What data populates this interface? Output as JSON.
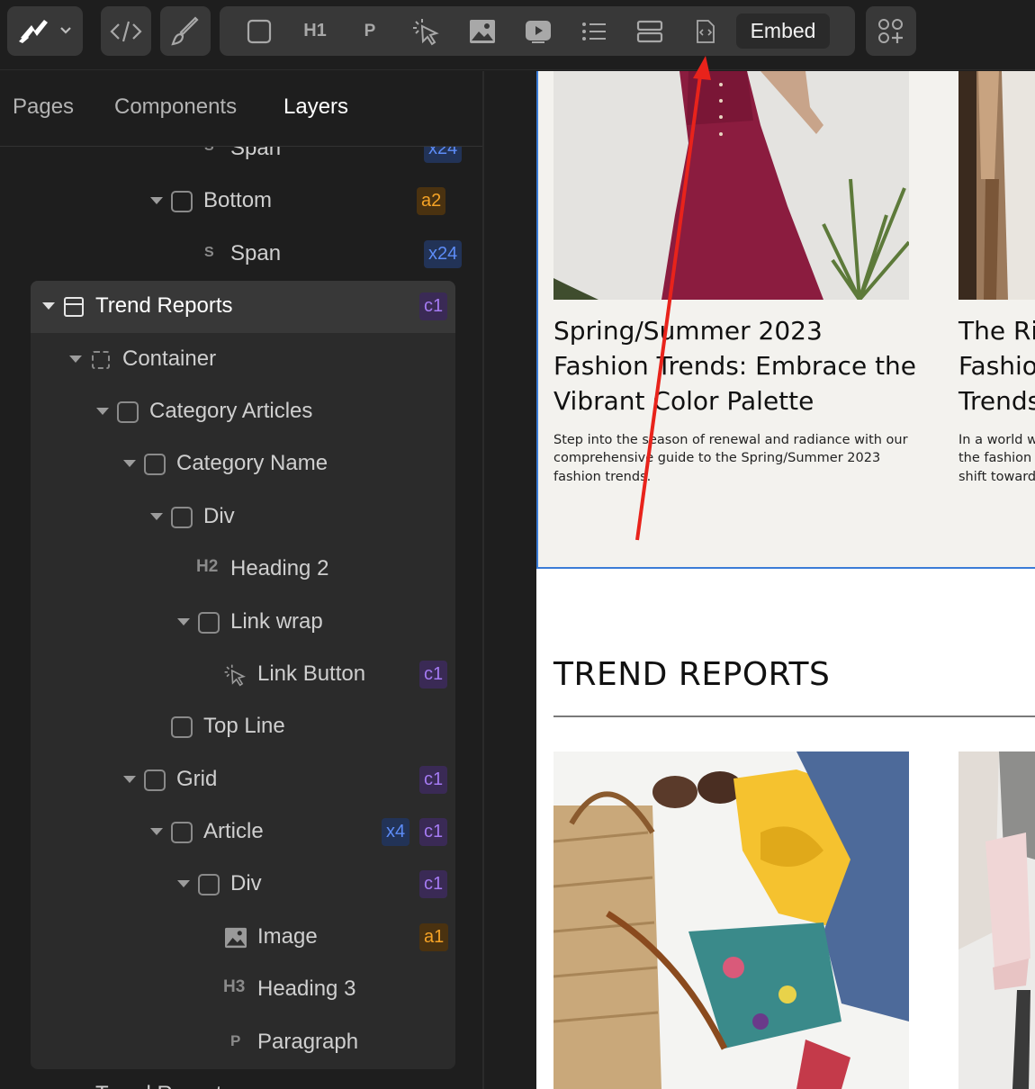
{
  "toolbar": {
    "icons": [
      "logo-icon",
      "chevron-down-icon",
      "code-icon",
      "brush-icon",
      "box-icon",
      "h1-icon",
      "p-icon",
      "link-button-icon",
      "image-icon",
      "video-icon",
      "list-icon",
      "stack-icon",
      "embed-file-icon",
      "add-more-icon"
    ],
    "h1_label": "H1",
    "p_label": "P",
    "embed_label": "Embed"
  },
  "panel_tabs": [
    {
      "label": "Pages",
      "active": false
    },
    {
      "label": "Components",
      "active": false
    },
    {
      "label": "Layers",
      "active": true
    }
  ],
  "layers": [
    {
      "label": "Span",
      "tag": "S",
      "badges": [
        {
          "text": "x24",
          "color": "blue"
        }
      ]
    },
    {
      "label": "Bottom",
      "tag": "",
      "badges": [
        {
          "text": "a2",
          "color": "orange"
        }
      ]
    },
    {
      "label": "Span",
      "tag": "S",
      "badges": [
        {
          "text": "x24",
          "color": "blue"
        }
      ]
    },
    {
      "label": "Trend Reports",
      "tag": "",
      "badges": [
        {
          "text": "c1",
          "color": "purple"
        }
      ]
    },
    {
      "label": "Container",
      "tag": "",
      "badges": []
    },
    {
      "label": "Category Articles",
      "tag": "",
      "badges": []
    },
    {
      "label": "Category Name",
      "tag": "",
      "badges": []
    },
    {
      "label": "Div",
      "tag": "",
      "badges": []
    },
    {
      "label": "Heading 2",
      "tag": "H2",
      "badges": []
    },
    {
      "label": "Link wrap",
      "tag": "",
      "badges": []
    },
    {
      "label": "Link Button",
      "tag": "",
      "badges": [
        {
          "text": "c1",
          "color": "purple"
        }
      ]
    },
    {
      "label": "Top Line",
      "tag": "",
      "badges": []
    },
    {
      "label": "Grid",
      "tag": "",
      "badges": [
        {
          "text": "c1",
          "color": "purple"
        }
      ]
    },
    {
      "label": "Article",
      "tag": "",
      "badges": [
        {
          "text": "x4",
          "color": "blue"
        },
        {
          "text": "c1",
          "color": "purple"
        }
      ]
    },
    {
      "label": "Div",
      "tag": "",
      "badges": [
        {
          "text": "c1",
          "color": "purple"
        }
      ]
    },
    {
      "label": "Image",
      "tag": "",
      "badges": [
        {
          "text": "a1",
          "color": "orange"
        }
      ]
    },
    {
      "label": "Heading 3",
      "tag": "H3",
      "badges": []
    },
    {
      "label": "Paragraph",
      "tag": "P",
      "badges": []
    },
    {
      "label": "Trend Reports",
      "tag": "",
      "badges": []
    }
  ],
  "canvas": {
    "card1": {
      "title_lines": [
        "Spring/Summer 2023",
        "Fashion Trends: Embrace the",
        "Vibrant Color Palette"
      ],
      "text_lines": [
        "Step into the season of renewal and radiance with our",
        "comprehensive guide to the Spring/Summer 2023",
        "fashion trends."
      ]
    },
    "card2": {
      "title_lines": [
        "The Ri",
        "Fashio",
        "Trends"
      ],
      "text_lines": [
        "In a world w",
        "the fashion i",
        "shift toward"
      ]
    },
    "section_heading": "TREND REPORTS"
  },
  "colors": {
    "accent_blue": "#3b7cd6",
    "annotation_red": "#e8231b",
    "badge_blue": "#5d8cf7",
    "badge_orange": "#f5a326",
    "badge_purple": "#a47af2"
  }
}
